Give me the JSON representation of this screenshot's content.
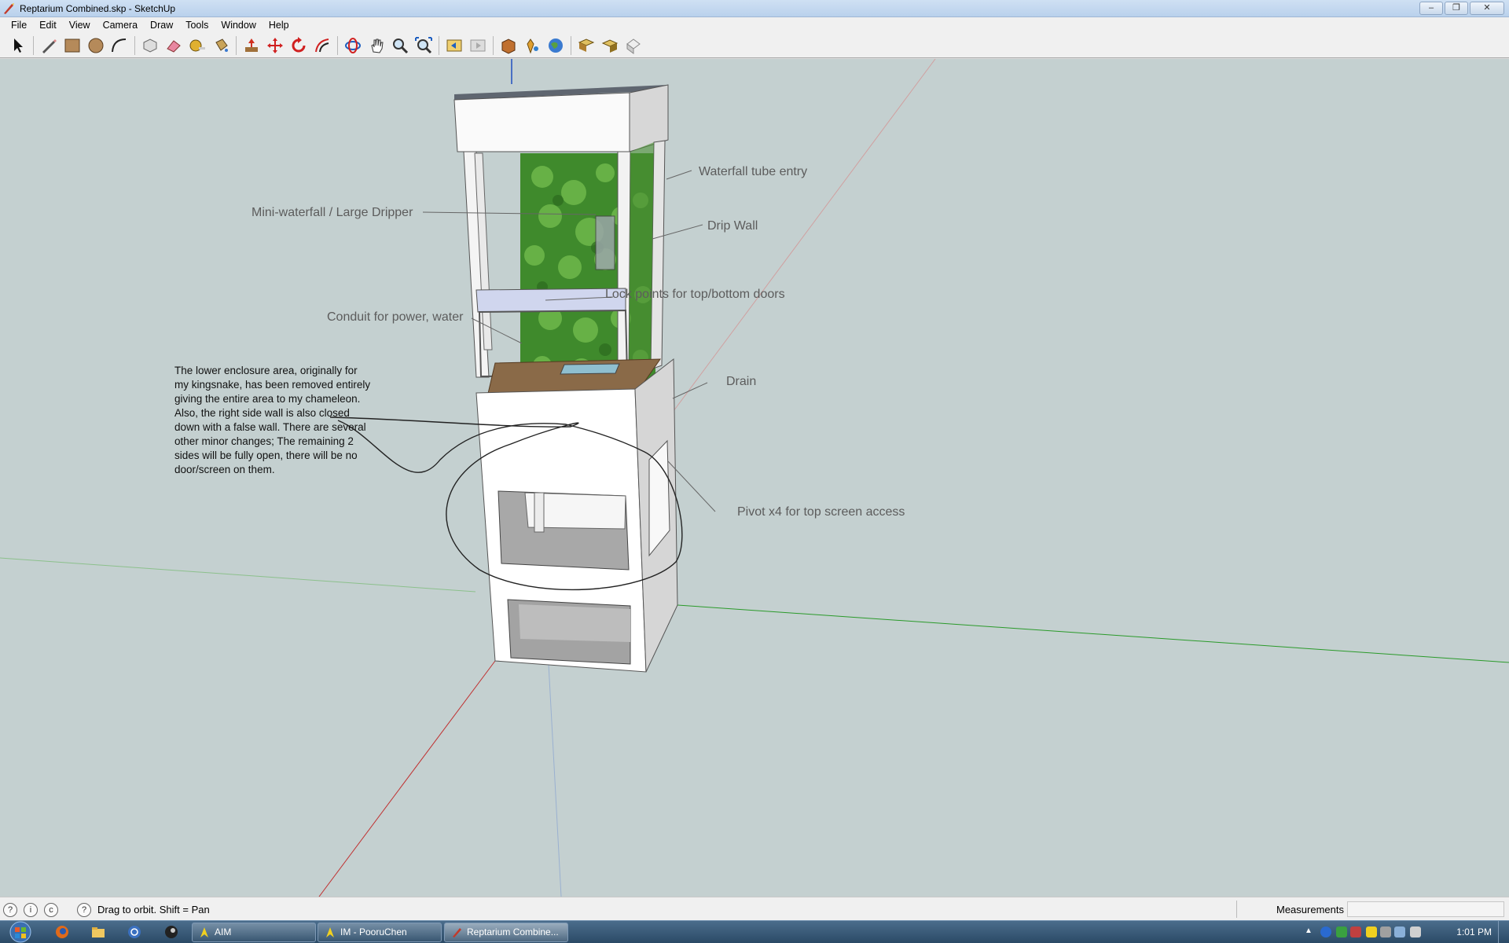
{
  "window": {
    "title": "Reptarium Combined.skp - SketchUp",
    "buttons": [
      "minimize-icon",
      "maximize-icon",
      "close-icon"
    ]
  },
  "menu": [
    "File",
    "Edit",
    "View",
    "Camera",
    "Draw",
    "Tools",
    "Window",
    "Help"
  ],
  "toolbar": [
    "select-icon",
    "pencil-icon",
    "rectangle-icon",
    "circle-icon",
    "arc-icon",
    "make-component-icon",
    "eraser-icon",
    "tape-measure-icon",
    "paint-bucket-icon",
    "push-pull-icon",
    "move-icon",
    "rotate-icon",
    "offset-icon",
    "orbit-icon",
    "pan-icon",
    "zoom-icon",
    "zoom-extents-icon",
    "previous-view-icon",
    "next-view-icon",
    "get-models-icon",
    "share-model-icon",
    "google-earth-icon",
    "get-photo-icon",
    "share-component-icon",
    "component-warehouse-icon"
  ],
  "labels": {
    "waterfall": "Waterfall tube entry",
    "dripper": "Mini-waterfall / Large Dripper",
    "dripwall": "Drip Wall",
    "lockpoints": "Lock points for top/bottom doors",
    "conduit": "Conduit for power, water",
    "drain": "Drain",
    "pivot": "Pivot x4 for top screen access"
  },
  "note": "The lower enclosure area, originally for my kingsnake, has been removed entirely giving the entire area to my chameleon. Also, the right side wall is also closed down with a false wall. There are several other minor changes; The remaining 2 sides will be fully open, there will be no door/screen on them.",
  "status": {
    "hint": "Drag to orbit.  Shift = Pan",
    "measurements_label": "Measurements",
    "measurements_value": ""
  },
  "taskbar": {
    "tasks": [
      "AIM",
      "IM - PooruChen",
      "Reptarium Combine..."
    ],
    "clock": "1:01 PM"
  }
}
